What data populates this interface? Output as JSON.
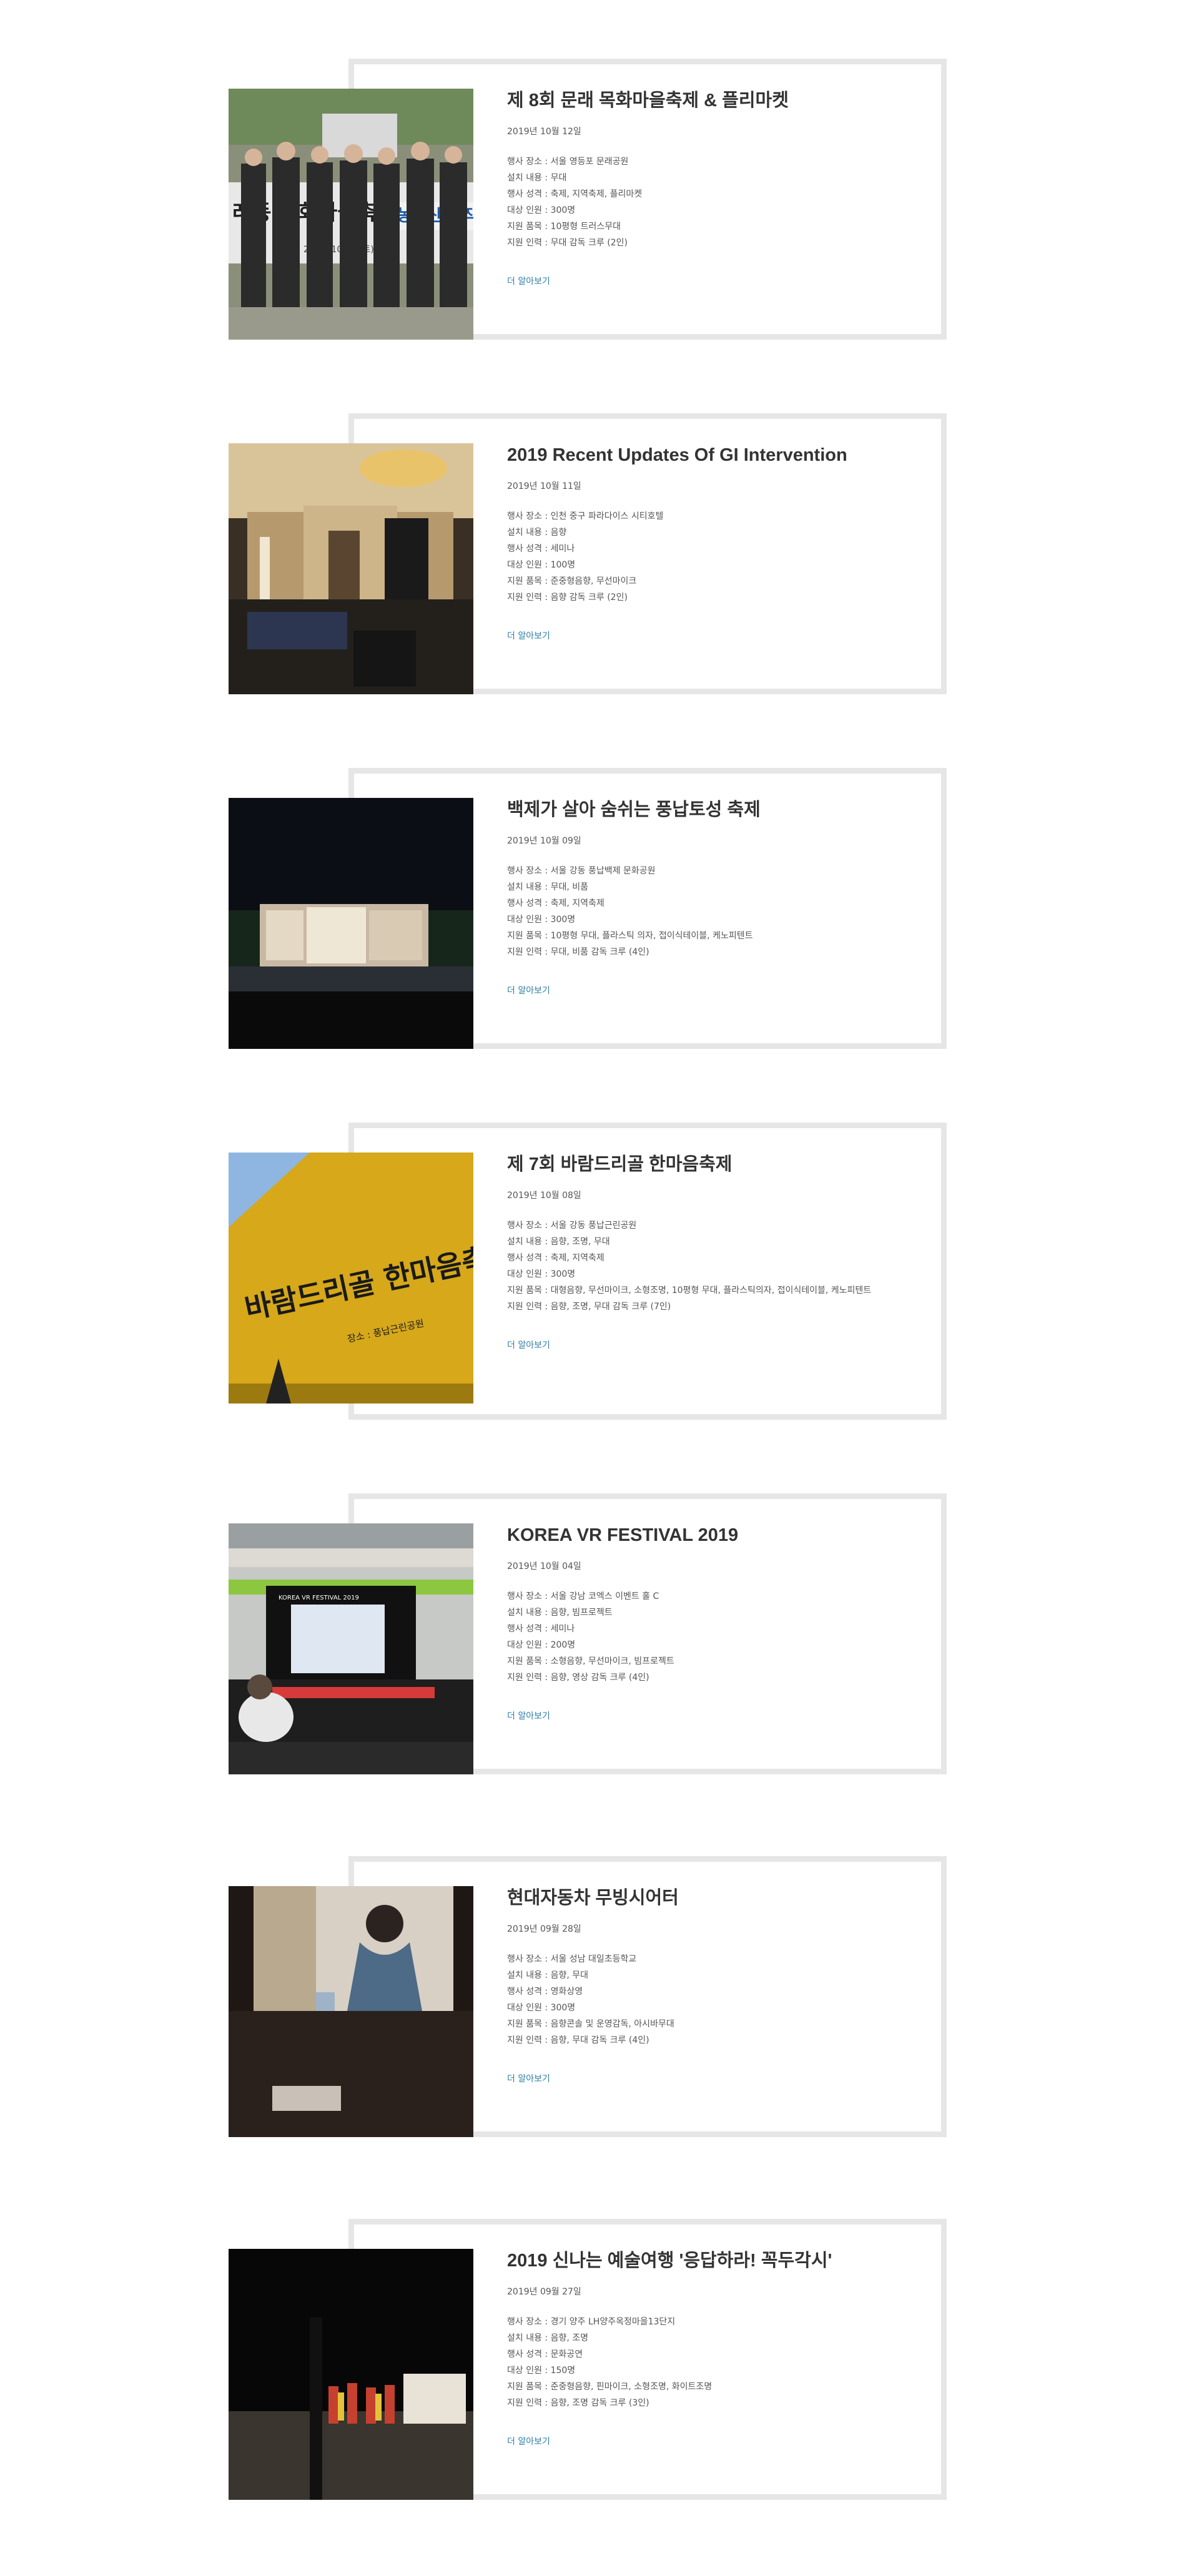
{
  "colors": {
    "frame": "#e6e6e6",
    "title": "#333333",
    "text": "#555555",
    "link": "#2d7fa9"
  },
  "events": [
    {
      "title": "제 8회 문래 목화마을축제 & 플리마켓",
      "date": "2019년 10월 12일",
      "details": [
        "행사 장소 : 서울 영등포 문래공원",
        "설치 내용 : 무대",
        "행사 성격 : 축제, 지역축제, 플리마켓",
        "대상 인원 : 300명",
        "지원 품목 : 10평형 트러스무대",
        "지원 인력 : 무대 감독 크루 (2인)"
      ],
      "more": "더 알아보기",
      "photo_text": [
        "레동 목화마을축제",
        "농특산물 직",
        "2019. 10. 12(토)"
      ]
    },
    {
      "title": "2019 Recent Updates Of GI Intervention",
      "date": "2019년 10월 11일",
      "details": [
        "행사 장소 : 인천 중구 파라다이스 시티호텔",
        "설치 내용 : 음향",
        "행사 성격 : 세미나",
        "대상 인원 : 100명",
        "지원 품목 : 준중형음향, 무선마이크",
        "지원 인력 : 음향 감독 크루 (2인)"
      ],
      "more": "더 알아보기"
    },
    {
      "title": "백제가 살아 숨쉬는 풍납토성 축제",
      "date": "2019년 10월 09일",
      "details": [
        "행사 장소 : 서울 강동 풍납백제 문화공원",
        "설치 내용 : 무대, 비품",
        "행사 성격 : 축제, 지역축제",
        "대상 인원 : 300명",
        "지원 품목 : 10평형 무대, 플라스틱 의자, 접이식테이블, 케노피텐트",
        "지원 인력 : 무대, 비품 감독 크루 (4인)"
      ],
      "more": "더 알아보기"
    },
    {
      "title": "제 7회 바람드리골 한마음축제",
      "date": "2019년 10월 08일",
      "details": [
        "행사 장소 : 서울 강동 풍납근린공원",
        "설치 내용 : 음향, 조명, 무대",
        "행사 성격 : 축제, 지역축제",
        "대상 인원 : 300명",
        "지원 품목 : 대형음향, 무선마이크, 소형조명, 10평형 무대, 플라스틱의자, 접이식테이블, 케노피텐트",
        "지원 인력 : 음향, 조명, 무대 감독 크루 (7인)"
      ],
      "more": "더 알아보기",
      "photo_text": [
        "바람드리골 한마음축제",
        "장소 : 풍납근린공원"
      ]
    },
    {
      "title": "KOREA VR FESTIVAL 2019",
      "date": "2019년 10월 04일",
      "details": [
        "행사 장소 : 서울 강남 코엑스 이벤트 홀 C",
        "설치 내용 : 음향, 빔프로젝트",
        "행사 성격 : 세미나",
        "대상 인원 : 200명",
        "지원 품목 : 소형음향, 무선마이크, 빔프로젝트",
        "지원 인력 : 음향, 영상 감독 크루 (4인)"
      ],
      "more": "더 알아보기",
      "photo_text": [
        "KOREA VR FESTIVAL 2019"
      ]
    },
    {
      "title": "현대자동차 무빙시어터",
      "date": "2019년 09월 28일",
      "details": [
        "행사 장소 : 서울 성남 대일초등학교",
        "설치 내용 : 음향, 무대",
        "행사 성격 : 영화상영",
        "대상 인원 : 300명",
        "지원 품목 : 음향콘솔 및 운영감독, 아시바무대",
        "지원 인력 : 음향, 무대 감독 크루 (4인)"
      ],
      "more": "더 알아보기"
    },
    {
      "title": "2019 신나는 예술여행 '응답하라! 꼭두각시'",
      "date": "2019년 09월 27일",
      "details": [
        "행사 장소 : 경기 양주 LH양주옥정마을13단지",
        "설치 내용 : 음향, 조명",
        "행사 성격 : 문화공연",
        "대상 인원 : 150명",
        "지원 품목 : 준중형음향, 핀마이크, 소형조명, 화이트조명",
        "지원 인력 : 음향, 조명 감독 크루 (3인)"
      ],
      "more": "더 알아보기"
    }
  ]
}
